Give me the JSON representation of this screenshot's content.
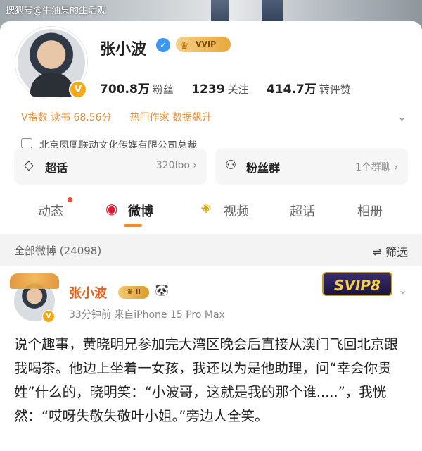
{
  "watermark": "搜狐号@牛油果的生活观",
  "profile": {
    "name": "张小波",
    "vvip_label": "VVIP",
    "stats": [
      {
        "value": "700.8万",
        "label": "粉丝"
      },
      {
        "value": "1239",
        "label": "关注"
      },
      {
        "value": "414.7万",
        "label": "转评赞"
      }
    ],
    "tags": [
      "V指数 读书 68.56分",
      "热门作家 数据飙升"
    ],
    "company": "北京凤凰联动文化传媒有限公司总裁"
  },
  "cards": {
    "left": {
      "title": "超话",
      "meta": "320lbo"
    },
    "right": {
      "title": "粉丝群",
      "meta": "1个群聊"
    }
  },
  "tabs": [
    "动态",
    "微博",
    "视频",
    "超话",
    "相册"
  ],
  "active_tab": "微博",
  "list_header": {
    "count": "全部微博 (24098)",
    "filter": "筛选"
  },
  "post": {
    "author": "张小波",
    "level": "II",
    "meta": "33分钟前  来自iPhone 15 Pro Max",
    "svip_label": "SVIP8",
    "body": "说个趣事，黄晓明兄参加完大湾区晚会后直接从澳门飞回北京跟我喝茶。他边上坐着一女孩，我还以为是他助理，问“幸会你贵姓”什么的，晓明笑：“小波哥，这就是我的那个谁.....”，我恍然：“哎呀失敬失敬叶小姐。”旁边人全笑。"
  },
  "colors": {
    "accent": "#f48a23",
    "orange_text": "#e3913a",
    "name_orange": "#e5621d",
    "verify_blue": "#3c98f0"
  },
  "icons": [
    "verified-icon",
    "shield-icon",
    "diamond-icon",
    "people-icon",
    "weibo-icon",
    "video-icon",
    "filter-icon",
    "chevron-down-icon",
    "chevron-right-icon",
    "panda-icon"
  ]
}
